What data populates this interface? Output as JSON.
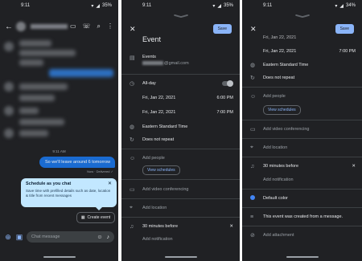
{
  "status": {
    "p1": {
      "time": "9:11",
      "battery": "35%"
    },
    "p2": {
      "time": "9:11",
      "battery": "35%"
    },
    "p3": {
      "time": "9:11",
      "battery": "34%"
    }
  },
  "chat": {
    "date_label": "9:11 AM",
    "outgoing_message": "So we'll leave around 6 tomorrow",
    "delivered_label": "Now · Delivered ✓",
    "schedule_card": {
      "title": "Schedule as you chat",
      "description": "Save time with prefilled details such as date, location & title from recent messages"
    },
    "create_event_label": "Create event",
    "compose_placeholder": "Chat message"
  },
  "event": {
    "save_label": "Save",
    "title": "Event",
    "calendar_label": "Events",
    "calendar_email_suffix": "@gmail.com",
    "all_day_label": "All-day",
    "start_date": "Fri, Jan 22, 2021",
    "start_time": "6:00 PM",
    "end_date": "Fri, Jan 22, 2021",
    "end_time": "7:00 PM",
    "timezone": "Eastern Standard Time",
    "repeat": "Does not repeat",
    "add_people": "Add people",
    "view_schedules": "View schedules",
    "add_video": "Add video conferencing",
    "add_location": "Add location",
    "notification": "30 minutes before",
    "add_notification": "Add notification",
    "default_color": "Default color",
    "description": "This event was created from a message.",
    "add_attachment": "Add attachment"
  },
  "colors": {
    "background": "#202124",
    "accent": "#8ab4f8",
    "bubble": "#1a6bd1",
    "card": "#c2e7ff",
    "event_color": "#4285f4"
  },
  "icons": [
    "arrow-back-icon",
    "video-icon",
    "phone-icon",
    "search-icon",
    "more-icon",
    "close-icon",
    "calendar-icon",
    "clock-icon",
    "globe-icon",
    "repeat-icon",
    "people-icon",
    "videocam-icon",
    "location-icon",
    "bell-icon",
    "color-dot-icon",
    "notes-icon",
    "attachment-icon",
    "add-icon",
    "gallery-icon",
    "emoji-icon",
    "mic-icon"
  ]
}
